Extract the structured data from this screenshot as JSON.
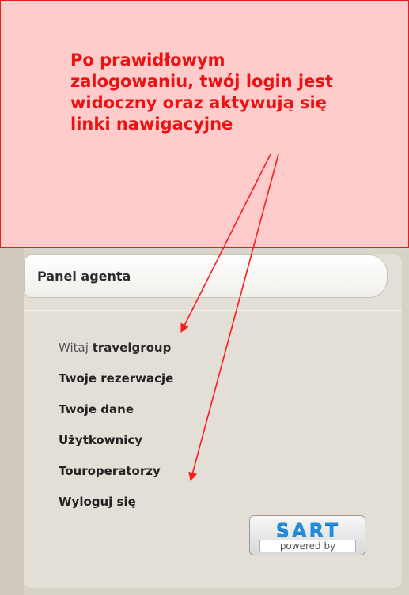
{
  "callout": {
    "text": "Po prawidłowym\nzalogowaniu, twój login jest\nwidoczny oraz aktywują się\nlinki nawigacyjne"
  },
  "panel": {
    "title": "Panel agenta",
    "greeting_prefix": "Witaj",
    "username": "travelgroup",
    "nav": [
      "Twoje rezerwacje",
      "Twoje dane",
      "Użytkownicy",
      "Touroperatorzy",
      "Wyloguj się"
    ]
  },
  "badge": {
    "logo": "SART",
    "sub": "powered by"
  },
  "colors": {
    "callout_bg": "#ffcccc",
    "callout_border": "#e02020",
    "callout_text": "#ee1111",
    "arrow": "#ff1a1a",
    "panel_bg": "#e3dfd6"
  }
}
